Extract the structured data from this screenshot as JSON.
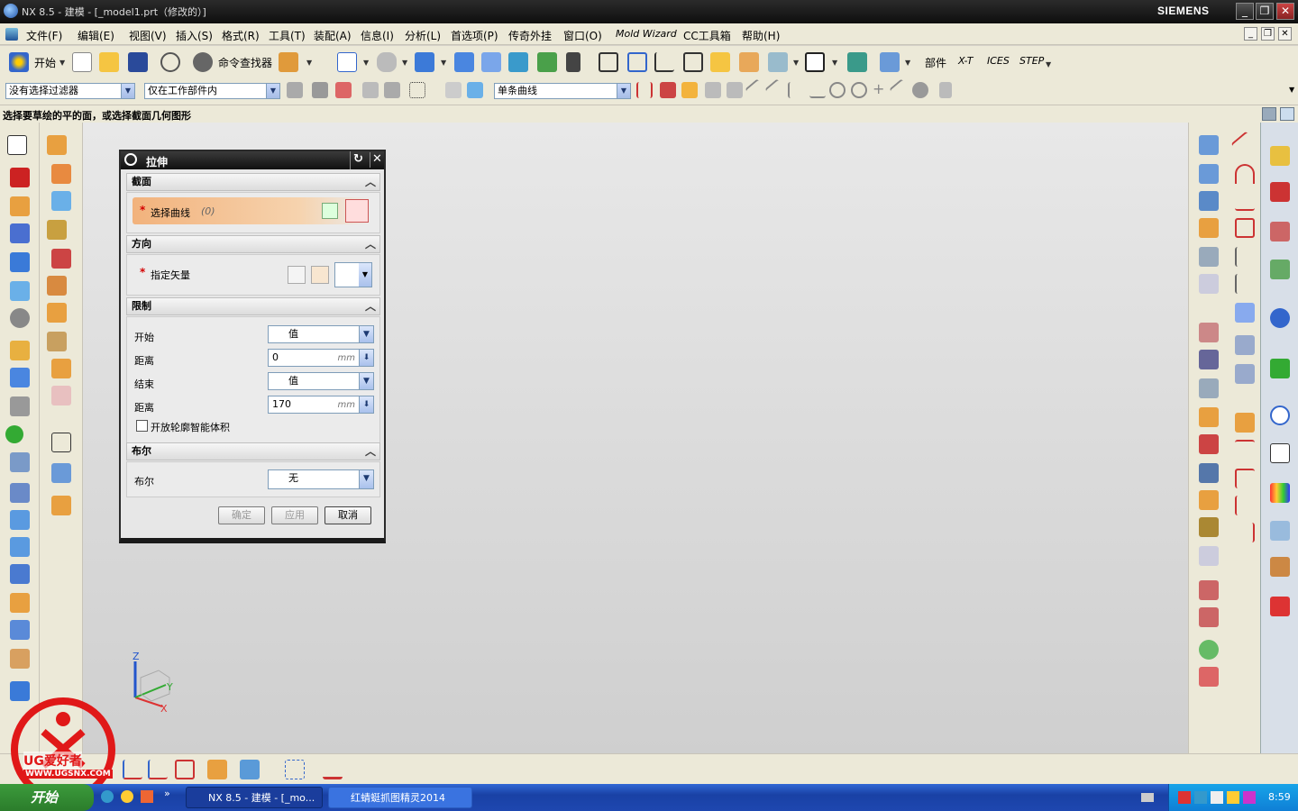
{
  "window": {
    "title": "NX 8.5 - 建模 - [_model1.prt（修改的）]",
    "brand": "SIEMENS",
    "controls": [
      "_",
      "❐",
      "✕"
    ]
  },
  "menu": {
    "items": [
      "文件(F)",
      "编辑(E)",
      "视图(V)",
      "插入(S)",
      "格式(R)",
      "工具(T)",
      "装配(A)",
      "信息(I)",
      "分析(L)",
      "首选项(P)",
      "传奇外挂",
      "窗口(O)",
      "Mold Wizard",
      "CC工具箱",
      "帮助(H)"
    ],
    "mdi_controls": [
      "_",
      "❐",
      "✕"
    ]
  },
  "toolbar": {
    "start_label": "开始",
    "command_finder_label": "命令查找器",
    "part_label": "部件",
    "xt_label": "X-T",
    "ices_label": "ICES",
    "step_label": "STEP"
  },
  "selection_bar": {
    "filter_value": "没有选择过滤器",
    "scope_value": "仅在工作部件内",
    "curve_rule_value": "单条曲线"
  },
  "cue_line": "选择要草绘的平的面，或选择截面几何图形",
  "dialog": {
    "title": "拉伸",
    "section": {
      "header": "截面",
      "select_curve_label": "选择曲线",
      "select_curve_count": "(0)"
    },
    "direction": {
      "header": "方向",
      "vector_label": "指定矢量"
    },
    "limits": {
      "header": "限制",
      "start_label": "开始",
      "start_value": "值",
      "start_distance_label": "距离",
      "start_distance_value": "0",
      "end_label": "结束",
      "end_value": "值",
      "end_distance_label": "距离",
      "end_distance_value": "170",
      "unit": "mm",
      "open_profile_label": "开放轮廓智能体积",
      "open_profile_checked": false
    },
    "boolean": {
      "header": "布尔",
      "label": "布尔",
      "value": "无"
    },
    "buttons": {
      "ok": "确定",
      "apply": "应用",
      "cancel": "取消"
    }
  },
  "triad": {
    "x": "X",
    "y": "Y",
    "z": "Z"
  },
  "watermark": {
    "text": "UG爱好者",
    "url": "WWW.UGSNX.COM"
  },
  "taskbar": {
    "start": "开始",
    "tasks": [
      "NX 8.5 - 建模 - [_mo...",
      "红蜻蜓抓图精灵2014"
    ],
    "clock": "8:59"
  },
  "colors": {
    "titlebar": "#111111",
    "taskbar": "#1e47b0",
    "dialog_header": "#1a1a1a",
    "select_curve_highlight": "#f2b27c",
    "required_star": "#d40000"
  }
}
